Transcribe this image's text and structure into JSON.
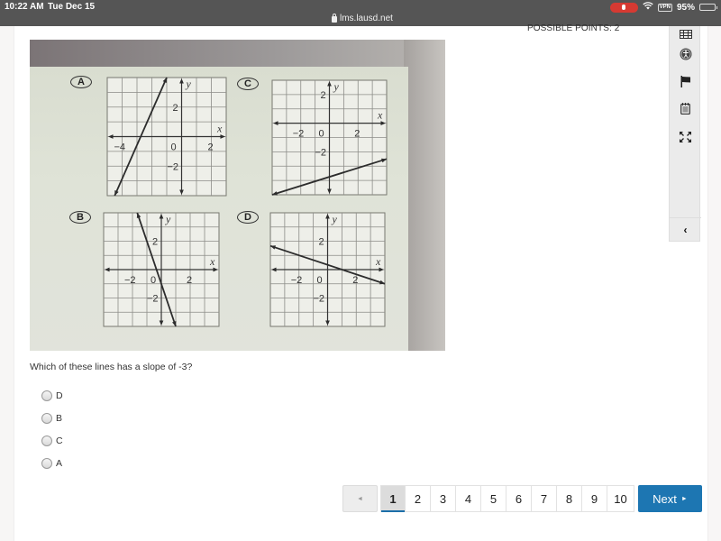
{
  "status_bar": {
    "time": "10:22 AM",
    "date": "Tue Dec 15",
    "url": "lms.lausd.net",
    "vpn_label": "VPN",
    "battery": "95%",
    "battery_level": 0.95
  },
  "header": {
    "possible_points": "POSSIBLE POINTS: 2"
  },
  "tool_panel": {
    "icons": [
      "calculator-icon",
      "accessibility-icon",
      "flag-icon",
      "notepad-icon",
      "fullscreen-icon"
    ],
    "collapse_label": "‹"
  },
  "question_image": {
    "graphs": [
      {
        "label": "A",
        "x_ticks": [
          "−4",
          "0",
          "2"
        ],
        "y_ticks": [
          "2",
          "−2"
        ],
        "x_name": "x",
        "y_name": "y",
        "x_range": [
          -5,
          3
        ],
        "y_range": [
          -4,
          4
        ],
        "line": {
          "from": [
            -4.5,
            -4
          ],
          "to": [
            -1,
            4
          ]
        }
      },
      {
        "label": "C",
        "x_ticks": [
          "−2",
          "0",
          "2"
        ],
        "y_ticks": [
          "2",
          "−2"
        ],
        "x_name": "x",
        "y_name": "y",
        "x_range": [
          -4,
          4
        ],
        "y_range": [
          -5,
          3
        ],
        "line": {
          "from": [
            -4,
            -5
          ],
          "to": [
            4,
            -2.5
          ]
        }
      },
      {
        "label": "B",
        "x_ticks": [
          "−2",
          "0",
          "2"
        ],
        "y_ticks": [
          "2",
          "−2"
        ],
        "x_name": "x",
        "y_name": "y",
        "x_range": [
          -4,
          4
        ],
        "y_range": [
          -4,
          4
        ],
        "line": {
          "from": [
            -1.67,
            4
          ],
          "to": [
            1,
            -4
          ]
        }
      },
      {
        "label": "D",
        "x_ticks": [
          "−2",
          "0",
          "2"
        ],
        "y_ticks": [
          "2",
          "−2"
        ],
        "x_name": "x",
        "y_name": "y",
        "x_range": [
          -4,
          4
        ],
        "y_range": [
          -4,
          4
        ],
        "line": {
          "from": [
            -4,
            1.67
          ],
          "to": [
            4,
            -1
          ]
        }
      }
    ]
  },
  "question": {
    "text": "Which of these lines has a slope of -3?",
    "options": [
      "D",
      "B",
      "C",
      "A"
    ]
  },
  "pagination": {
    "prev_label": "◄",
    "pages": [
      "1",
      "2",
      "3",
      "4",
      "5",
      "6",
      "7",
      "8",
      "9",
      "10"
    ],
    "current": "1",
    "next_label": "Next",
    "next_icon": "►"
  }
}
